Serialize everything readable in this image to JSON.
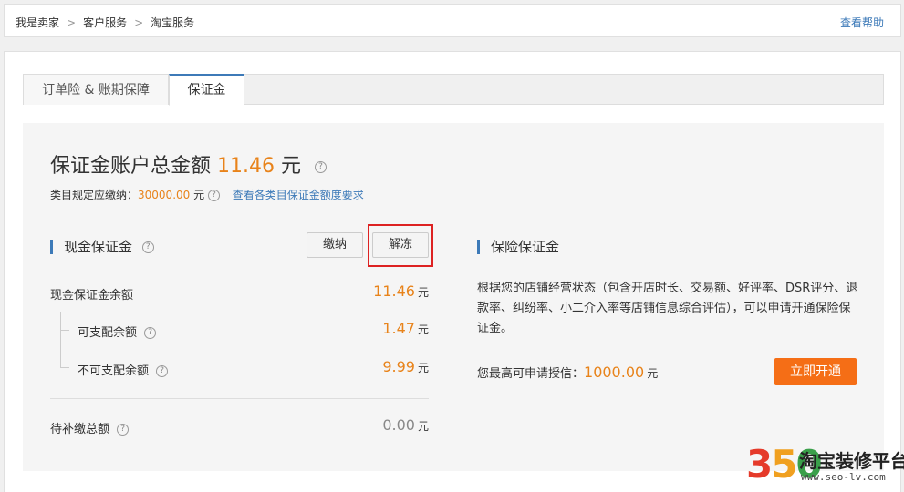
{
  "breadcrumb": {
    "items": [
      "我是卖家",
      "客户服务",
      "淘宝服务"
    ],
    "separator": ">"
  },
  "help_link": "查看帮助",
  "tabs": [
    {
      "label": "订单险 & 账期保障",
      "active": false
    },
    {
      "label": "保证金",
      "active": true
    }
  ],
  "account": {
    "title": "保证金账户总金额",
    "amount": "11.46",
    "unit": "元",
    "required_label": "类目规定应缴纳：",
    "required_amount": "30000.00",
    "required_unit": "元",
    "required_link": "查看各类目保证金额度要求"
  },
  "cash": {
    "heading": "现金保证金",
    "pay_button": "缴纳",
    "release_button": "解冻",
    "balance_label": "现金保证金余额",
    "balance_value": "11.46",
    "available_label": "可支配余额",
    "available_value": "1.47",
    "unavailable_label": "不可支配余额",
    "unavailable_value": "9.99",
    "pending_label": "待补缴总额",
    "pending_value": "0.00",
    "unit": "元"
  },
  "insurance": {
    "heading": "保险保证金",
    "description": "根据您的店铺经营状态（包含开店时长、交易额、好评率、DSR评分、退款率、纠纷率、小二介入率等店铺信息综合评估），可以申请开通保险保证金。",
    "credit_label": "您最高可申请授信：",
    "credit_value": "1000.00",
    "unit": "元",
    "open_button": "立即开通"
  },
  "watermark": {
    "number": "350",
    "text": "淘宝装修平台",
    "url": "www.seo-lv.com"
  },
  "colors": {
    "accent_blue": "#3d7ab8",
    "amount_orange": "#e8831a",
    "cta_orange": "#f56e16",
    "highlight_red": "#dd2222"
  }
}
